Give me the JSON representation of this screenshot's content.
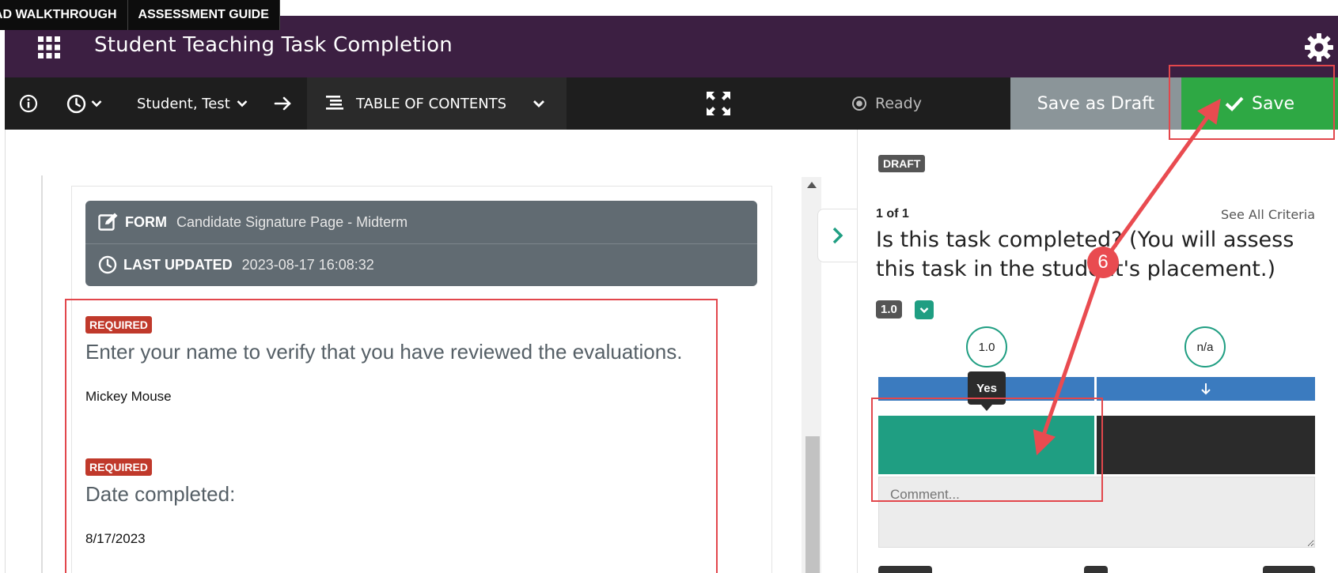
{
  "guide_tabs": [
    "AD WALKTHROUGH",
    "ASSESSMENT GUIDE"
  ],
  "header": {
    "title": "Student Teaching Task Completion"
  },
  "toolbar": {
    "student": "Student, Test",
    "toc": "TABLE OF CONTENTS",
    "status": "Ready",
    "save_draft": "Save as Draft",
    "save": "Save"
  },
  "form": {
    "form_label": "FORM",
    "form_name": "Candidate Signature Page - Midterm",
    "updated_label": "LAST UPDATED",
    "updated_value": "2023-08-17 16:08:32",
    "questions": [
      {
        "badge": "REQUIRED",
        "question": "Enter your name to verify that you have reviewed the evaluations.",
        "answer": "Mickey Mouse"
      },
      {
        "badge": "REQUIRED",
        "question": "Date completed:",
        "answer": "8/17/2023"
      }
    ]
  },
  "assessment": {
    "badge": "DRAFT",
    "counter": "1 of 1",
    "see_all": "See All Criteria",
    "question": "Is this task completed? (You will assess this task in the student's placement.)",
    "score": "1.0",
    "levels": [
      {
        "value": "1.0",
        "label": "Yes"
      },
      {
        "value": "n/a"
      }
    ],
    "comment_placeholder": "Comment..."
  },
  "annotation": {
    "step": "6"
  },
  "colors": {
    "header": "#3c1f42",
    "toolbar": "#1e1e1e",
    "save": "#2ea844",
    "teal": "#1f9e82",
    "blue": "#3b7bbf",
    "highlight": "#e2474c"
  }
}
